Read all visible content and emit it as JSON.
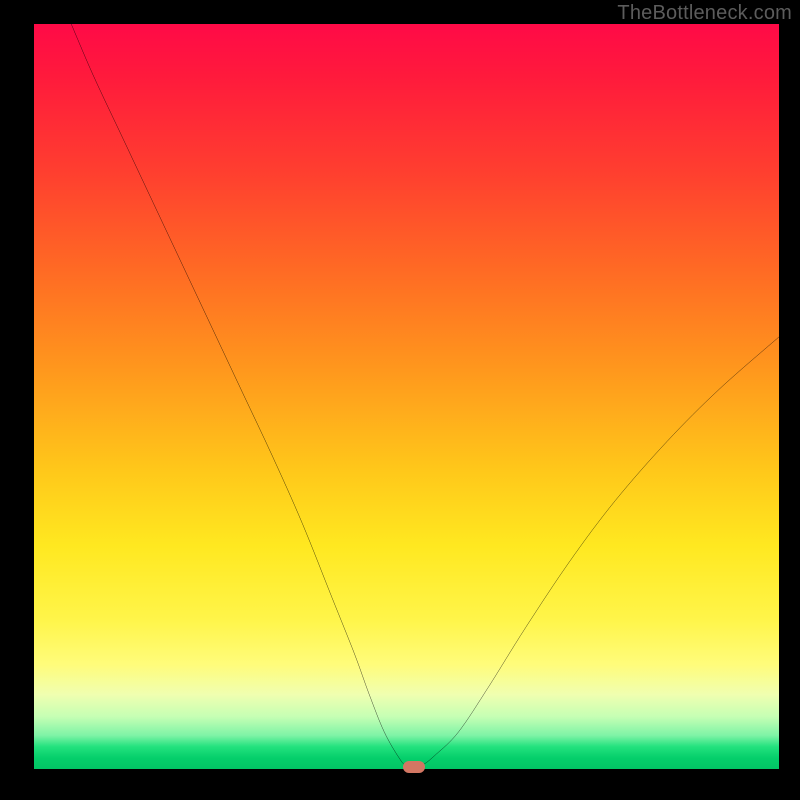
{
  "watermark": "TheBottleneck.com",
  "colors": {
    "frame": "#000000",
    "curve_stroke": "#000000",
    "marker": "#d37763",
    "gradient_top": "#ff0a47",
    "gradient_bottom": "#02c565"
  },
  "chart_data": {
    "type": "line",
    "title": "",
    "xlabel": "",
    "ylabel": "",
    "xlim": [
      0,
      100
    ],
    "ylim": [
      0,
      100
    ],
    "note": "No axis ticks or numeric labels are rendered; values estimated from curve pixel positions on a 0–100 normalized grid.",
    "series": [
      {
        "name": "bottleneck-curve",
        "x": [
          5,
          8,
          12,
          16,
          20,
          24,
          28,
          32,
          36,
          40,
          43,
          45,
          47,
          49,
          50,
          52,
          54,
          57,
          61,
          66,
          72,
          78,
          85,
          92,
          100
        ],
        "y": [
          100,
          93,
          84.5,
          76,
          67.5,
          59,
          50.5,
          42,
          33,
          23,
          15.5,
          10,
          5,
          1.5,
          0.5,
          0.5,
          2,
          5,
          11,
          19,
          28,
          36,
          44,
          51,
          58
        ]
      }
    ],
    "marker": {
      "x": 51,
      "y": 0.3,
      "label": ""
    },
    "grid": false,
    "legend": false
  }
}
